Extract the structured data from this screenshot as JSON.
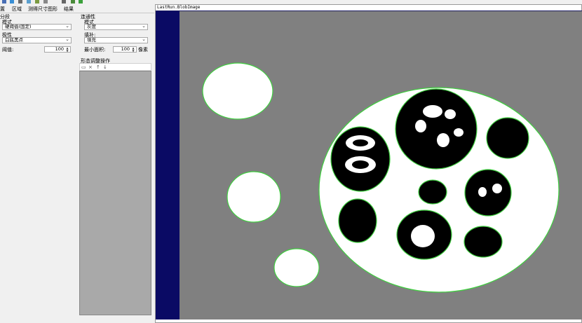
{
  "colors": {
    "panel_bg": "#f0f0f0",
    "image_bg": "#808080",
    "blob_white": "#ffffff",
    "blob_black": "#000000",
    "contour": "#3fcf3f",
    "border_strip": "#0a0a64",
    "list_bg": "#a9a9a9"
  },
  "toolbar_icons": [
    "pointer-icon",
    "image-icon",
    "camera-icon",
    "flask-icon",
    "tool-icon",
    "gear-icon",
    "window-icon",
    "chart-icon",
    "run-icon"
  ],
  "tabs": [
    "置",
    "区域",
    "测得尺寸",
    "图形",
    "结果"
  ],
  "segment": {
    "header": "分段",
    "mode_label": "模式",
    "mode_value": "硬阈值(固定)",
    "polarity_label": "极性",
    "polarity_value": "白底黑点",
    "threshold_label": "阈值:",
    "threshold_value": "100"
  },
  "connectivity": {
    "header": "连通性",
    "mode_label": "模式",
    "mode_value": "灰度",
    "fill_label": "填补:",
    "fill_value": "填充",
    "min_area_label": "最小面积:",
    "min_area_value": "100",
    "min_area_unit": "像素"
  },
  "morph": {
    "header": "形态调整操作",
    "icons": [
      "folder-icon",
      "delete-icon",
      "move-up-icon",
      "move-down-icon"
    ]
  },
  "image_window": {
    "title": "LastRun.BlobImage"
  }
}
